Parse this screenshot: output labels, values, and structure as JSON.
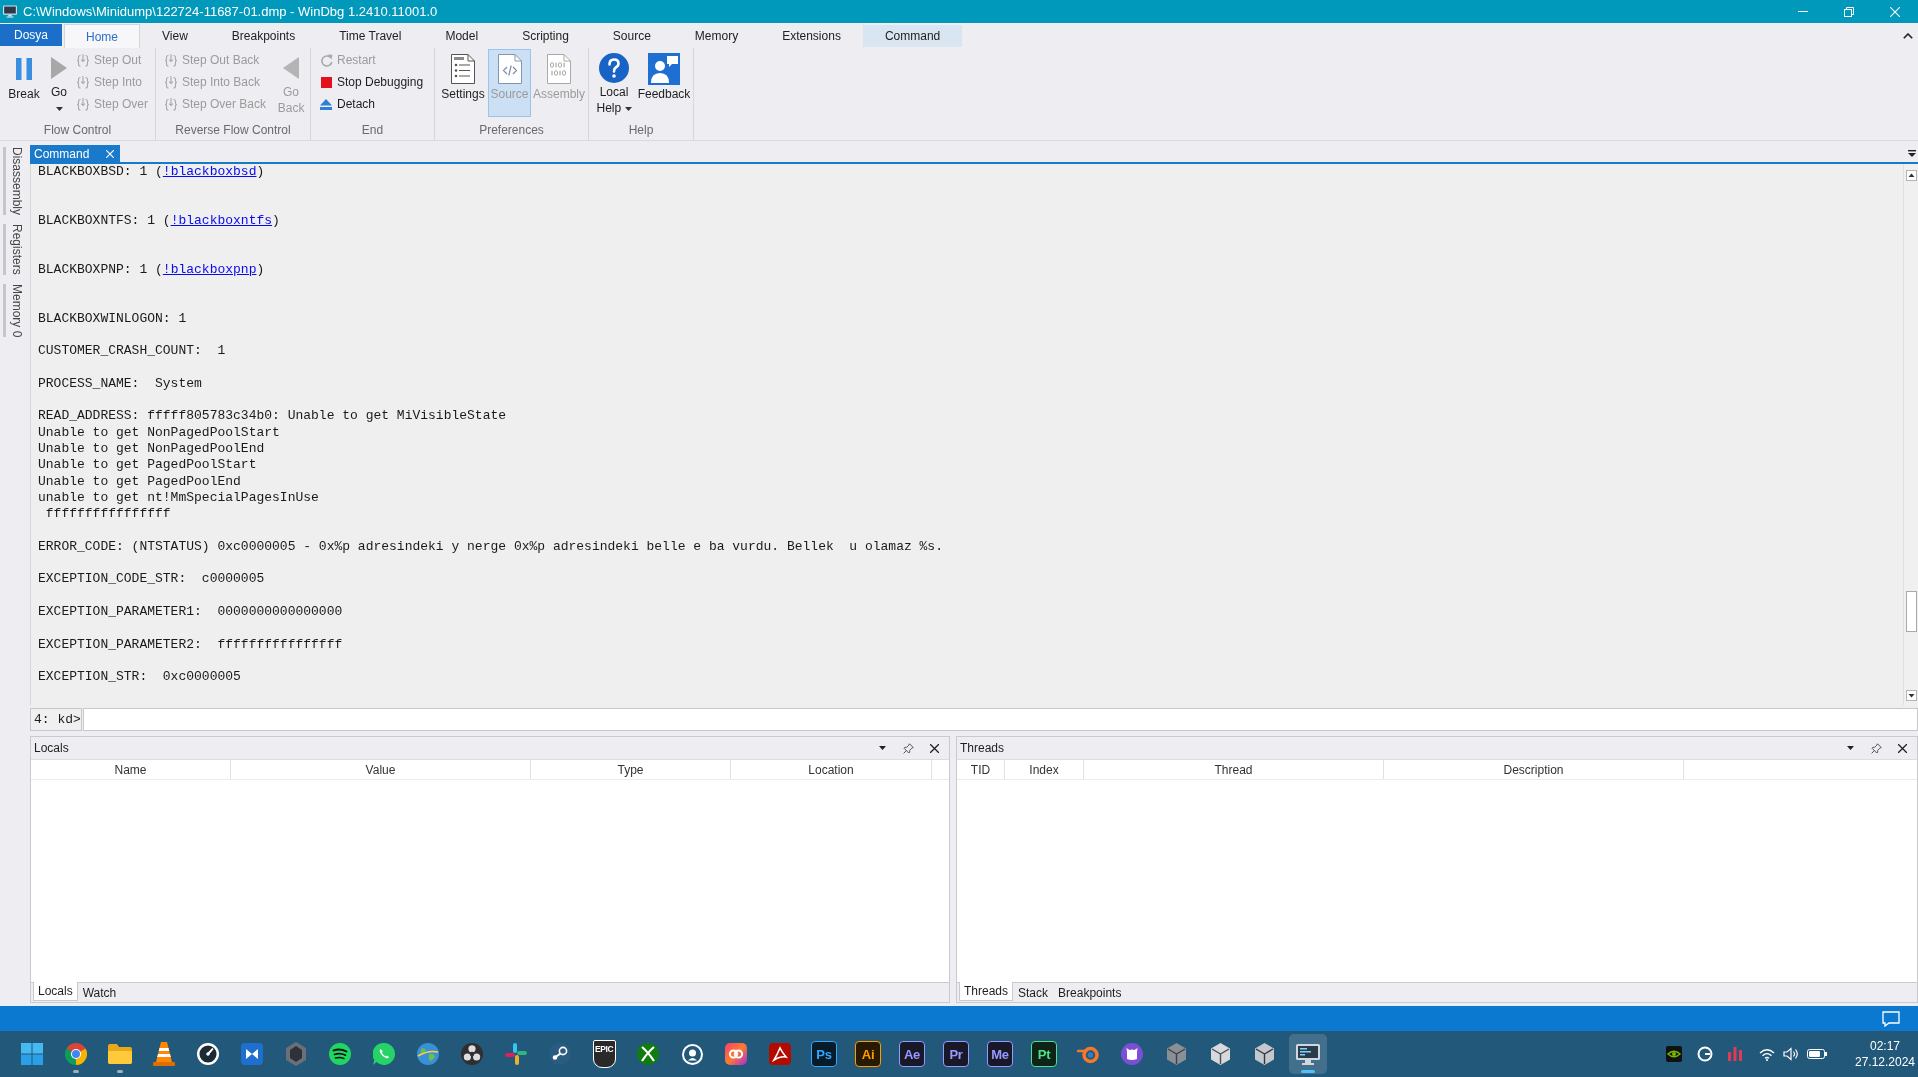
{
  "window": {
    "title": "C:\\Windows\\Minidump\\122724-11687-01.dmp - WinDbg 1.2410.11001.0"
  },
  "ribbon": {
    "tabs": [
      {
        "label": "Dosya",
        "kind": "file",
        "selected": false
      },
      {
        "label": "Home",
        "kind": "tab",
        "selected": true
      },
      {
        "label": "View",
        "kind": "tab",
        "selected": false
      },
      {
        "label": "Breakpoints",
        "kind": "tab",
        "selected": false
      },
      {
        "label": "Time Travel",
        "kind": "tab",
        "selected": false
      },
      {
        "label": "Model",
        "kind": "tab",
        "selected": false
      },
      {
        "label": "Scripting",
        "kind": "tab",
        "selected": false
      },
      {
        "label": "Source",
        "kind": "tab",
        "selected": false
      },
      {
        "label": "Memory",
        "kind": "tab",
        "selected": false
      },
      {
        "label": "Extensions",
        "kind": "tab",
        "selected": false
      },
      {
        "label": "Command",
        "kind": "contextual",
        "selected": false
      }
    ],
    "groups": [
      {
        "label": "Flow Control",
        "items": [
          {
            "label": "Break",
            "kind": "large",
            "disabled": false,
            "dropdown": false
          },
          {
            "label": "Go",
            "kind": "large",
            "disabled": false,
            "dropdown": true
          },
          {
            "label": "Step Out",
            "kind": "small",
            "disabled": true,
            "dropdown": false
          },
          {
            "label": "Step Into",
            "kind": "small",
            "disabled": true,
            "dropdown": false
          },
          {
            "label": "Step Over",
            "kind": "small",
            "disabled": true,
            "dropdown": false
          }
        ]
      },
      {
        "label": "Reverse Flow Control",
        "items": [
          {
            "label": "Step Out Back",
            "kind": "small",
            "disabled": true,
            "dropdown": false
          },
          {
            "label": "Step Into Back",
            "kind": "small",
            "disabled": true,
            "dropdown": false
          },
          {
            "label": "Step Over Back",
            "kind": "small",
            "disabled": true,
            "dropdown": false
          },
          {
            "label": "Go Back",
            "kind": "large",
            "disabled": true,
            "dropdown": false
          }
        ]
      },
      {
        "label": "End",
        "items": [
          {
            "label": "Restart",
            "kind": "small",
            "disabled": true,
            "dropdown": false
          },
          {
            "label": "Stop Debugging",
            "kind": "small",
            "disabled": false,
            "dropdown": false
          },
          {
            "label": "Detach",
            "kind": "small",
            "disabled": false,
            "dropdown": false
          }
        ]
      },
      {
        "label": "Preferences",
        "items": [
          {
            "label": "Settings",
            "kind": "large",
            "disabled": false,
            "dropdown": false,
            "checked": false
          },
          {
            "label": "Source",
            "kind": "large",
            "disabled": true,
            "dropdown": false,
            "checked": true
          },
          {
            "label": "Assembly",
            "kind": "large",
            "disabled": true,
            "dropdown": false,
            "checked": false
          }
        ]
      },
      {
        "label": "Help",
        "items": [
          {
            "label": "Local Help",
            "kind": "large",
            "disabled": false,
            "dropdown": true
          },
          {
            "label": "Feedback",
            "kind": "large",
            "disabled": false,
            "dropdown": false
          }
        ]
      }
    ]
  },
  "side_tabs": [
    "Disassembly",
    "Registers",
    "Memory 0"
  ],
  "command_window": {
    "tab": "Command",
    "output": [
      {
        "kind": "link",
        "text": "BLACKBOXBSD: 1 (",
        "link": "!blackboxbsd",
        "suffix": ")"
      },
      {
        "kind": "link",
        "text": "BLACKBOXNTFS: 1 (",
        "link": "!blackboxntfs",
        "suffix": ")"
      },
      {
        "kind": "link",
        "text": "BLACKBOXPNP: 1 (",
        "link": "!blackboxpnp",
        "suffix": ")"
      },
      {
        "kind": "plain",
        "lines": [
          "BLACKBOXWINLOGON: 1"
        ]
      },
      {
        "kind": "plain",
        "lines": [
          "CUSTOMER_CRASH_COUNT:  1"
        ]
      },
      {
        "kind": "plain",
        "lines": [
          "PROCESS_NAME:  System"
        ]
      },
      {
        "kind": "plain",
        "lines": [
          "READ_ADDRESS: fffff805783c34b0: Unable to get MiVisibleState",
          "Unable to get NonPagedPoolStart",
          "Unable to get NonPagedPoolEnd",
          "Unable to get PagedPoolStart",
          "Unable to get PagedPoolEnd",
          "unable to get nt!MmSpecialPagesInUse",
          " ffffffffffffffff"
        ]
      },
      {
        "kind": "plain",
        "lines": [
          "ERROR_CODE: (NTSTATUS) 0xc0000005 - 0x%p adresindeki y nerge 0x%p adresindeki belle e ba vurdu. Bellek  u olamaz %s."
        ]
      },
      {
        "kind": "plain",
        "lines": [
          "EXCEPTION_CODE_STR:  c0000005"
        ]
      },
      {
        "kind": "plain",
        "lines": [
          "EXCEPTION_PARAMETER1:  0000000000000000"
        ]
      },
      {
        "kind": "plain",
        "lines": [
          "EXCEPTION_PARAMETER2:  ffffffffffffffff"
        ]
      },
      {
        "kind": "plain",
        "lines": [
          "EXCEPTION_STR:  0xc0000005"
        ]
      }
    ],
    "prompt": "4: kd>"
  },
  "tool_windows": [
    {
      "title": "Locals",
      "columns": [
        "Name",
        "Value",
        "Type",
        "Location"
      ],
      "tabs": [
        {
          "label": "Locals",
          "selected": true
        },
        {
          "label": "Watch",
          "selected": false
        }
      ]
    },
    {
      "title": "Threads",
      "columns": [
        "TID",
        "Index",
        "Thread",
        "Description"
      ],
      "tabs": [
        {
          "label": "Threads",
          "selected": true
        },
        {
          "label": "Stack",
          "selected": false
        },
        {
          "label": "Breakpoints",
          "selected": false
        }
      ]
    }
  ],
  "taskbar": {
    "apps": [
      {
        "kind": "icon",
        "running": false,
        "active": false
      },
      {
        "kind": "icon",
        "running": true,
        "active": false
      },
      {
        "kind": "icon",
        "running": true,
        "active": false
      },
      {
        "kind": "icon",
        "running": false,
        "active": false
      },
      {
        "kind": "icon",
        "running": false,
        "active": false
      },
      {
        "kind": "icon",
        "running": false,
        "active": false
      },
      {
        "kind": "icon",
        "running": false,
        "active": false
      },
      {
        "kind": "icon",
        "running": false,
        "active": false
      },
      {
        "kind": "icon",
        "running": false,
        "active": false
      },
      {
        "kind": "icon",
        "running": false,
        "active": false
      },
      {
        "kind": "icon",
        "running": false,
        "active": false
      },
      {
        "kind": "icon",
        "running": false,
        "active": false
      },
      {
        "kind": "icon",
        "running": false,
        "active": false
      },
      {
        "kind": "shield",
        "label": "EPIC",
        "color": "#ffffff",
        "running": false,
        "active": false
      },
      {
        "kind": "icon",
        "running": false,
        "active": false
      },
      {
        "kind": "icon",
        "running": false,
        "active": false
      },
      {
        "kind": "icon",
        "running": false,
        "active": false
      },
      {
        "kind": "icon",
        "running": false,
        "active": false
      },
      {
        "kind": "tile",
        "label": "Ps",
        "color": "#31a8ff",
        "running": false,
        "active": false
      },
      {
        "kind": "tile",
        "label": "Ai",
        "color": "#ff9a00",
        "running": false,
        "active": false
      },
      {
        "kind": "tile",
        "label": "Ae",
        "color": "#9999ff",
        "running": false,
        "active": false
      },
      {
        "kind": "tile",
        "label": "Pr",
        "color": "#9999ff",
        "running": false,
        "active": false
      },
      {
        "kind": "tile",
        "label": "Me",
        "color": "#9999ff",
        "running": false,
        "active": false
      },
      {
        "kind": "tile",
        "label": "Pt",
        "color": "#4fe08a",
        "running": false,
        "active": false
      },
      {
        "kind": "icon",
        "running": false,
        "active": false
      },
      {
        "kind": "icon",
        "running": false,
        "active": false
      },
      {
        "kind": "icon",
        "running": false,
        "active": false
      },
      {
        "kind": "icon",
        "running": false,
        "active": false
      },
      {
        "kind": "icon",
        "running": false,
        "active": false
      },
      {
        "kind": "icon",
        "running": true,
        "active": true
      }
    ],
    "clock": {
      "time": "02:17",
      "date": "27.12.2024"
    }
  }
}
